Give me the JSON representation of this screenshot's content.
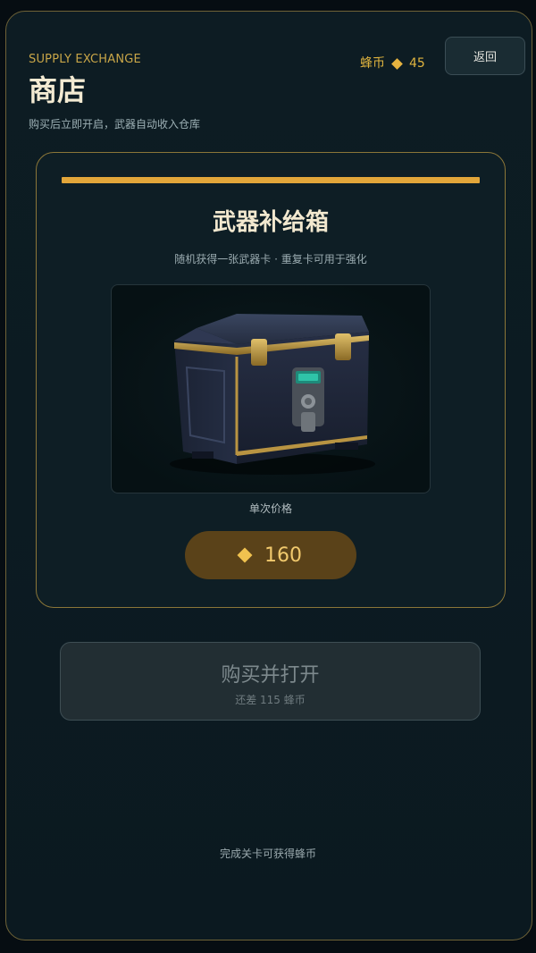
{
  "header": {
    "eyebrow": "SUPPLY EXCHANGE",
    "title": "商店",
    "subtitle": "购买后立即开启，武器自动收入仓库",
    "currency_label": "蜂币",
    "currency_amount": "45",
    "back_label": "返回"
  },
  "card": {
    "title": "武器补给箱",
    "description": "随机获得一张武器卡 · 重复卡可用于强化",
    "image_icon": "supply-crate",
    "price_label": "单次价格",
    "price": "160"
  },
  "buy": {
    "label": "购买并打开",
    "sublabel": "还差 115 蜂币",
    "disabled": true
  },
  "footer": {
    "hint": "完成关卡可获得蜂币"
  },
  "colors": {
    "accent": "#e2a63a",
    "gold": "#e0b43f",
    "background": "#0c1b22"
  }
}
